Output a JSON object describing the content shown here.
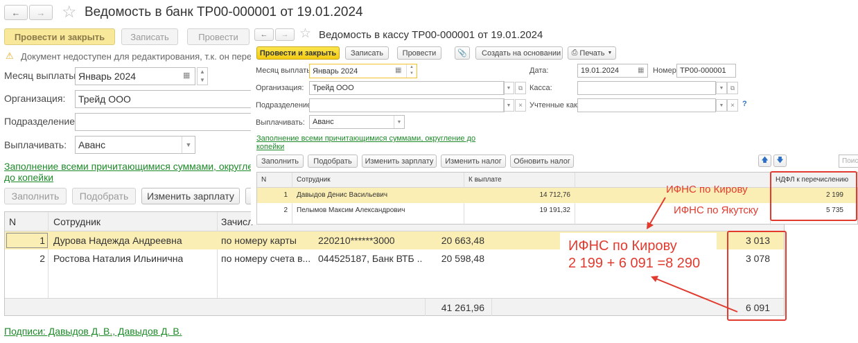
{
  "back_form": {
    "title": "Ведомость в банк ТР00-000001 от 19.01.2024",
    "buttons": {
      "post_close": "Провести и закрыть",
      "save": "Записать",
      "post": "Провести"
    },
    "warning": "Документ недоступен для редактирования, т.к. он пере",
    "month_label": "Месяц выплаты:",
    "month_value": "Январь 2024",
    "org_label": "Организация:",
    "org_value": "Трейд ООО",
    "dept_label": "Подразделение:",
    "dept_value": "",
    "pay_label": "Выплачивать:",
    "pay_value": "Аванс",
    "fill_link": "Заполнение всеми причитающимися суммами, округление",
    "fill_link2": "до копейки",
    "table_buttons": {
      "fill": "Заполнить",
      "pick": "Подобрать",
      "change_salary": "Изменить зарплату"
    },
    "table": {
      "headers": {
        "n": "N",
        "employee": "Сотрудник",
        "credit": "Зачисл"
      },
      "rows": [
        {
          "n": "1",
          "employee": "Дурова Надежда Андреевна",
          "method": "по номеру карты",
          "account": "220210******3000",
          "amount": "20 663,48",
          "tax": "3 013"
        },
        {
          "n": "2",
          "employee": "Ростова Наталия Ильинична",
          "method": "по номеру счета в...",
          "account": "044525187, Банк ВТБ ...",
          "amount": "20 598,48",
          "tax": "3 078"
        }
      ],
      "total_amount": "41 261,96",
      "total_tax": "6 091"
    },
    "signatures": "Подписи: Давыдов Д. В., Давыдов Д. В."
  },
  "front_form": {
    "title": "Ведомость в кассу ТР00-000001 от 19.01.2024",
    "buttons": {
      "post_close": "Провести и закрыть",
      "save": "Записать",
      "post": "Провести",
      "create_based": "Создать на основании",
      "print": "Печать"
    },
    "month_label": "Месяц выплаты:",
    "month_value": "Январь 2024",
    "date_label": "Дата:",
    "date_value": "19.01.2024",
    "number_label": "Номер:",
    "number_value": "ТР00-000001",
    "org_label": "Организация:",
    "org_value": "Трейд ООО",
    "cash_label": "Касса:",
    "cash_value": "",
    "dept_label": "Подразделение:",
    "dept_value": "",
    "accounted_label": "Учтенные как:",
    "accounted_value": "",
    "help": "?",
    "pay_label": "Выплачивать:",
    "pay_value": "Аванс",
    "fill_link": "Заполнение всеми причитающимися суммами, округление до",
    "fill_link2": "копейки",
    "table_buttons": {
      "fill": "Заполнить",
      "pick": "Подобрать",
      "change_salary": "Изменить зарплату",
      "change_tax": "Изменить налог",
      "update_tax": "Обновить налог"
    },
    "search_placeholder": "Поис",
    "table": {
      "headers": {
        "n": "N",
        "employee": "Сотрудник",
        "payout": "К выплате",
        "ndfl": "НДФЛ к перечислению"
      },
      "rows": [
        {
          "n": "1",
          "employee": "Давыдов Денис Васильевич",
          "payout": "14 712,76",
          "ndfl": "2 199"
        },
        {
          "n": "2",
          "employee": "Пелымов Максим Александрович",
          "payout": "19 191,32",
          "ndfl": "5 735"
        }
      ]
    }
  },
  "annotations": {
    "kirov_small": "ИФНС по Кирову",
    "yakutsk": "ИФНС по Якутску",
    "kirov_big": "ИФНС по Кирову",
    "formula": "2 199 + 6 091 =8 290"
  },
  "colors": {
    "accent_red": "#e13b2f",
    "link_green": "#1d8a28",
    "selected_row": "#fbeeb4",
    "post_button": "#f3cb14"
  }
}
